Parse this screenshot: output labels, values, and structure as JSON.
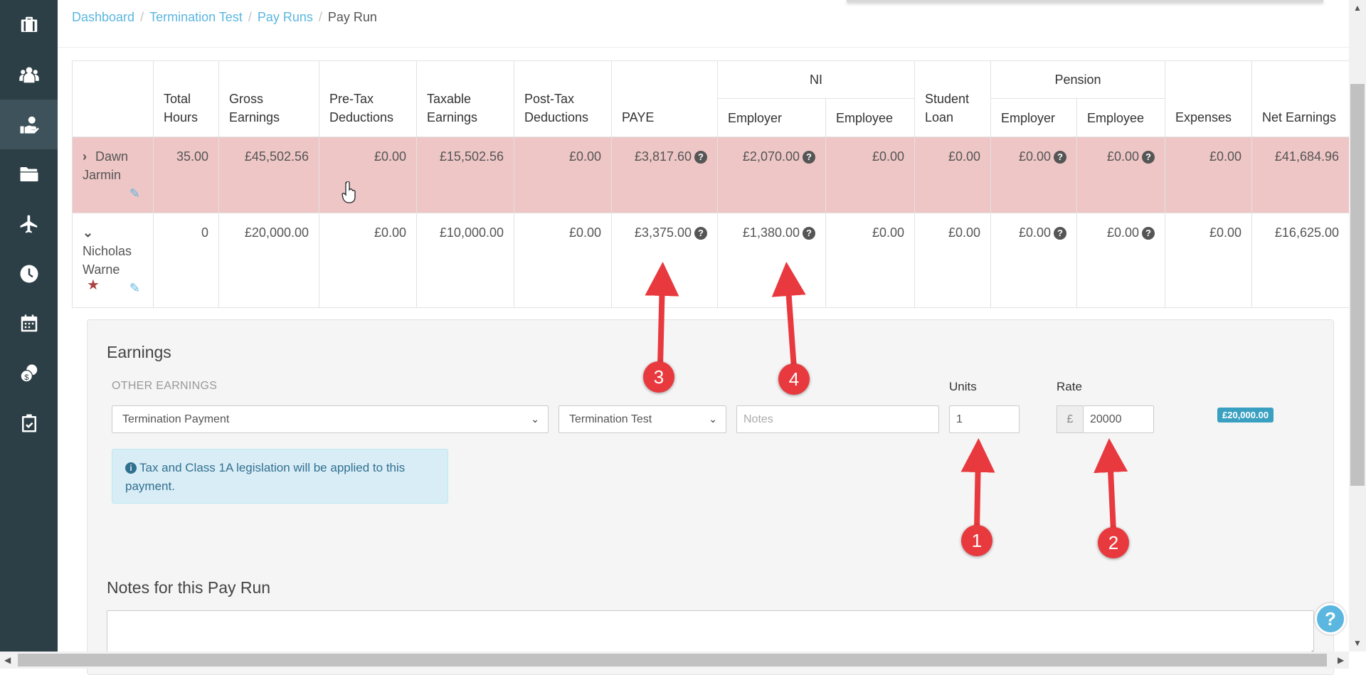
{
  "sidebar": {
    "items": [
      {
        "icon": "briefcase-icon"
      },
      {
        "icon": "people-icon"
      },
      {
        "icon": "payment-hand-icon"
      },
      {
        "icon": "folder-icon"
      },
      {
        "icon": "plane-icon"
      },
      {
        "icon": "clock-icon"
      },
      {
        "icon": "calendar-icon"
      },
      {
        "icon": "coins-icon"
      },
      {
        "icon": "clipboard-check-icon"
      }
    ]
  },
  "breadcrumb": {
    "items": [
      "Dashboard",
      "Termination Test",
      "Pay Runs"
    ],
    "current": "Pay Run",
    "separator": "/"
  },
  "table": {
    "headers": {
      "total_hours": "Total Hours",
      "gross_earnings": "Gross Earnings",
      "pre_tax": "Pre-Tax Deductions",
      "taxable": "Taxable Earnings",
      "post_tax": "Post-Tax Deductions",
      "paye": "PAYE",
      "ni": "NI",
      "ni_employer": "Employer",
      "ni_employee": "Employee",
      "student_loan": "Student Loan",
      "pension": "Pension",
      "pension_employer": "Employer",
      "pension_employee": "Employee",
      "expenses": "Expenses",
      "net_earnings": "Net Earnings"
    },
    "rows": [
      {
        "name": "Dawn Jarmin",
        "total_hours": "35.00",
        "gross": "£45,502.56",
        "pre_tax": "£0.00",
        "taxable": "£15,502.56",
        "post_tax": "£0.00",
        "paye": "£3,817.60",
        "ni_employer": "£2,070.00",
        "ni_employee": "£0.00",
        "student_loan": "£0.00",
        "pension_employer": "£0.00",
        "pension_employee": "£0.00",
        "expenses": "£0.00",
        "net": "£41,684.96"
      },
      {
        "name": "Nicholas Warne",
        "total_hours": "0",
        "gross": "£20,000.00",
        "pre_tax": "£0.00",
        "taxable": "£10,000.00",
        "post_tax": "£0.00",
        "paye": "£3,375.00",
        "ni_employer": "£1,380.00",
        "ni_employee": "£0.00",
        "student_loan": "£0.00",
        "pension_employer": "£0.00",
        "pension_employee": "£0.00",
        "expenses": "£0.00",
        "net": "£16,625.00"
      }
    ]
  },
  "earnings": {
    "title": "Earnings",
    "section_label": "OTHER EARNINGS",
    "units_label": "Units",
    "rate_label": "Rate",
    "type_select": "Termination Payment",
    "company_select": "Termination Test",
    "notes_placeholder": "Notes",
    "units_value": "1",
    "currency_symbol": "£",
    "rate_value": "20000",
    "amount_badge": "£20,000.00",
    "alert_text": "Tax and Class 1A legislation will be applied to this payment."
  },
  "notes_section": {
    "title": "Notes for this Pay Run"
  },
  "annotations": [
    "1",
    "2",
    "3",
    "4"
  ],
  "colors": {
    "sidebar": "#2c3e46",
    "link": "#5bb6e0",
    "highlight_row": "#efc6c6",
    "annotation_red": "#e8393e",
    "badge_blue": "#3aa0c2"
  }
}
